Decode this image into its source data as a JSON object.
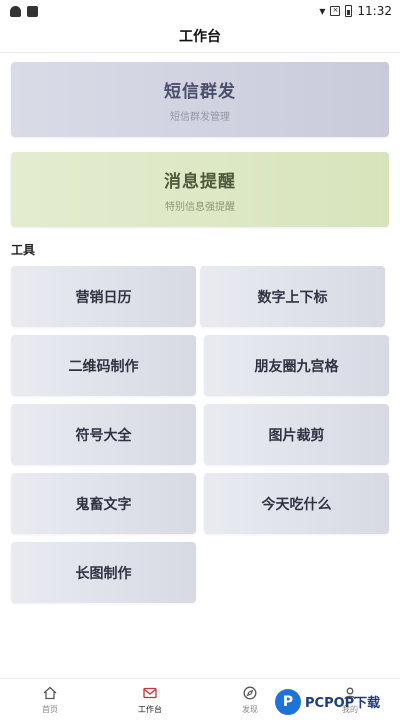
{
  "status": {
    "time": "11:32"
  },
  "header": {
    "title": "工作台"
  },
  "banners": [
    {
      "title": "短信群发",
      "subtitle": "短信群发管理",
      "color": "#c9cbdb"
    },
    {
      "title": "消息提醒",
      "subtitle": "特别信息强提醒",
      "color": "#d7e4bb"
    }
  ],
  "tools_section": {
    "label": "工具"
  },
  "tools": [
    "营销日历",
    "数字上下标",
    "二维码制作",
    "朋友圈九宫格",
    "符号大全",
    "图片裁剪",
    "鬼畜文字",
    "今天吃什么",
    "长图制作"
  ],
  "tabbar": {
    "items": [
      {
        "label": "首页",
        "icon": "home-icon"
      },
      {
        "label": "工作台",
        "icon": "mail-icon"
      },
      {
        "label": "发现",
        "icon": "compass-icon"
      },
      {
        "label": "我的",
        "icon": "user-icon"
      }
    ]
  },
  "watermark": {
    "logo_letter": "P",
    "text": "PCPOP下载"
  }
}
